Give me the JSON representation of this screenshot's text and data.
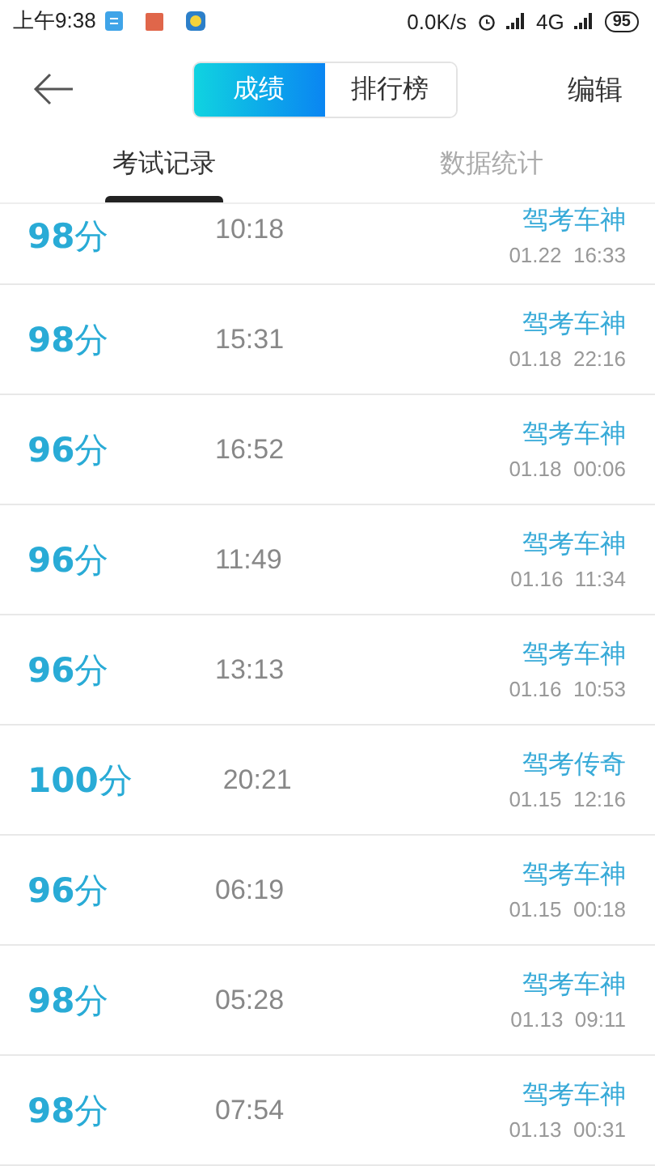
{
  "status_bar": {
    "time": "上午9:38",
    "speed": "0.0K/s",
    "network": "4G",
    "battery": "95"
  },
  "header": {
    "segments": [
      {
        "label": "成绩",
        "selected": true
      },
      {
        "label": "排行榜",
        "selected": false
      }
    ],
    "action": "编辑"
  },
  "tabs": [
    {
      "label": "考试记录",
      "selected": true
    },
    {
      "label": "数据统计",
      "selected": false
    }
  ],
  "records": [
    {
      "score": "**98**分",
      "duration": "10:18",
      "title": "驾考车神",
      "date": "01.22  16:33"
    },
    {
      "score": "**98**分",
      "duration": "15:31",
      "title": "驾考车神",
      "date": "01.18  22:16"
    },
    {
      "score": "**96**分",
      "duration": "16:52",
      "title": "驾考车神",
      "date": "01.18  00:06"
    },
    {
      "score": "**96**分",
      "duration": "11:49",
      "title": "驾考车神",
      "date": "01.16  11:34"
    },
    {
      "score": "**96**分",
      "duration": "13:13",
      "title": "驾考车神",
      "date": "01.16  10:53"
    },
    {
      "score": "**100**分",
      "duration": "20:21",
      "title": "驾考传奇",
      "date": "01.15  12:16"
    },
    {
      "score": "**96**分",
      "duration": "06:19",
      "title": "驾考车神",
      "date": "01.15  00:18"
    },
    {
      "score": "**98**分",
      "duration": "05:28",
      "title": "驾考车神",
      "date": "01.13  09:11"
    },
    {
      "score": "**98**分",
      "duration": "07:54",
      "title": "驾考车神",
      "date": "01.13  00:31"
    }
  ]
}
